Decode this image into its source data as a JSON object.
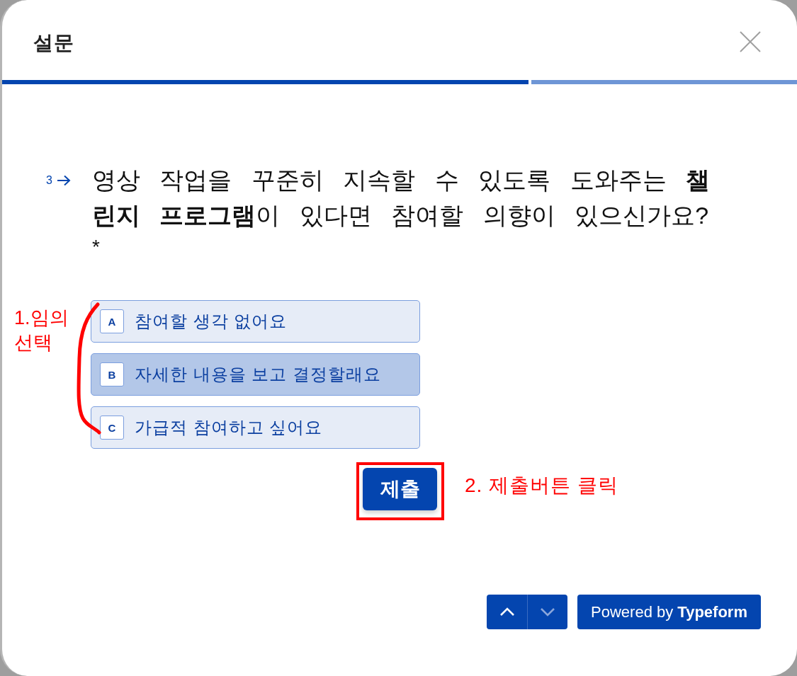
{
  "dialog": {
    "title": "설문"
  },
  "progress": {
    "level": 0.666
  },
  "question": {
    "number": "3",
    "text": "영상 작업을 꾸준히 지속할 수 있도록 도와주는 **챌린지 프로그램**이 있다면 참여할 의향이 있으신가요?",
    "required_mark": "*"
  },
  "choices": [
    {
      "key": "A",
      "label": "참여할 생각 없어요",
      "selected": false
    },
    {
      "key": "B",
      "label": "자세한 내용을 보고 결정할래요",
      "selected": true
    },
    {
      "key": "C",
      "label": "가급적 참여하고 싶어요",
      "selected": false
    }
  ],
  "submit_button": {
    "label": "제출"
  },
  "navigation": [
    {
      "kind": "up",
      "disabled": false
    },
    {
      "kind": "down",
      "disabled": true
    }
  ],
  "branding": {
    "text": "Powered by **Typeform**"
  },
  "annotations": {
    "choice_note": "1.임의 선택",
    "submit_note": "2. 제출버튼 클릭"
  }
}
